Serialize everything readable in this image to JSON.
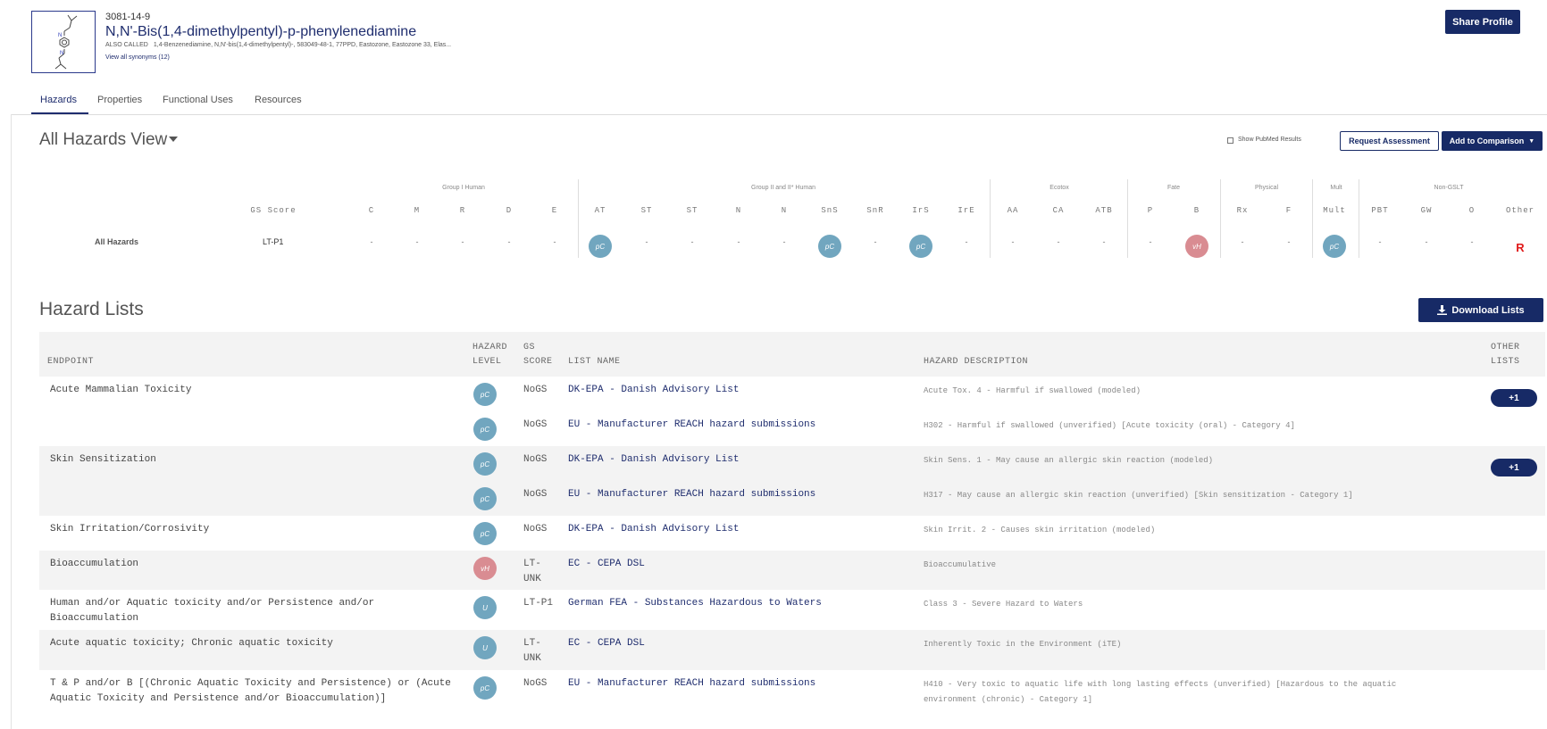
{
  "header": {
    "cas": "3081-14-9",
    "name": "N,N'-Bis(1,4-dimethylpentyl)-p-phenylenediamine",
    "also_called_label": "ALSO CALLED",
    "also_called": "1,4-Benzenediamine, N,N'-bis(1,4-dimethylpentyl)-, 583049-48-1, 77PPD, Eastozone, Eastozone 33, Elas...",
    "view_synonyms": "View all synonyms (12)",
    "share_label": "Share Profile"
  },
  "tabs": [
    "Hazards",
    "Properties",
    "Functional Uses",
    "Resources"
  ],
  "hazards_view": {
    "title": "All Hazards View",
    "pubmed_label": "Show PubMed Results",
    "request_label": "Request Assessment",
    "compare_label": "Add to Comparison"
  },
  "groups": [
    "Group I Human",
    "Group II and II* Human",
    "Ecotox",
    "Fate",
    "Physical",
    "Mult",
    "Non-GSLT"
  ],
  "columns": [
    "GS Score",
    "C",
    "M",
    "R",
    "D",
    "E",
    "AT",
    "ST",
    "ST",
    "N",
    "N",
    "SnS",
    "SnR",
    "IrS",
    "IrE",
    "AA",
    "CA",
    "ATB",
    "P",
    "B",
    "Rx",
    "F",
    "Mult",
    "PBT",
    "GW",
    "O",
    "Other"
  ],
  "all_hazards_row": {
    "label": "All Hazards",
    "gs_score": "LT-P1",
    "cells": [
      "-",
      "-",
      "-",
      "-",
      "-",
      "pC",
      "-",
      "-",
      "-",
      "-",
      "pC",
      "-",
      "pC",
      "-",
      "-",
      "-",
      "-",
      "-",
      "vH",
      "-",
      "-",
      "pC",
      "-",
      "-",
      "-",
      "R"
    ]
  },
  "hazard_lists": {
    "title": "Hazard Lists",
    "download_label": "Download Lists",
    "headers": {
      "endpoint": "ENDPOINT",
      "hazard_level_1": "HAZARD",
      "hazard_level_2": "LEVEL",
      "gs_score_1": "GS",
      "gs_score_2": "SCORE",
      "list_name": "LIST NAME",
      "hazard_description": "HAZARD DESCRIPTION",
      "other_lists_1": "OTHER",
      "other_lists_2": "LISTS"
    },
    "rows": [
      {
        "endpoint": "Acute Mammalian Toxicity",
        "level": "pC",
        "gs": "NoGS",
        "list": "DK-EPA - Danish Advisory List",
        "desc": "Acute Tox. 4 - Harmful if swallowed (modeled)",
        "other": "+1"
      },
      {
        "endpoint": "",
        "level": "pC",
        "gs": "NoGS",
        "list": "EU - Manufacturer REACH hazard submissions",
        "desc": "H302 - Harmful if swallowed (unverified) [Acute toxicity (oral) - Category 4]",
        "other": ""
      },
      {
        "endpoint": "Skin Sensitization",
        "level": "pC",
        "gs": "NoGS",
        "list": "DK-EPA - Danish Advisory List",
        "desc": "Skin Sens. 1 - May cause an allergic skin reaction (modeled)",
        "other": "+1"
      },
      {
        "endpoint": "",
        "level": "pC",
        "gs": "NoGS",
        "list": "EU - Manufacturer REACH hazard submissions",
        "desc": "H317 - May cause an allergic skin reaction (unverified) [Skin sensitization - Category 1]",
        "other": ""
      },
      {
        "endpoint": "Skin Irritation/Corrosivity",
        "level": "pC",
        "gs": "NoGS",
        "list": "DK-EPA - Danish Advisory List",
        "desc": "Skin Irrit. 2 - Causes skin irritation (modeled)",
        "other": ""
      },
      {
        "endpoint": "Bioaccumulation",
        "level": "vH",
        "gs": "LT-\nUNK",
        "list": "EC - CEPA DSL",
        "desc": "Bioaccumulative",
        "other": ""
      },
      {
        "endpoint": "Human and/or Aquatic toxicity and/or Persistence and/or\nBioaccumulation",
        "level": "U",
        "gs": "LT-P1",
        "list": "German FEA - Substances Hazardous to Waters",
        "desc": "Class 3 - Severe Hazard to Waters",
        "other": ""
      },
      {
        "endpoint": "Acute aquatic toxicity; Chronic aquatic toxicity",
        "level": "U",
        "gs": "LT-\nUNK",
        "list": "EC - CEPA DSL",
        "desc": "Inherently Toxic in the Environment (iTE)",
        "other": ""
      },
      {
        "endpoint": "T & P and/or B [(Chronic Aquatic Toxicity and Persistence) or (Acute\nAquatic Toxicity and Persistence and/or Bioaccumulation)]",
        "level": "pC",
        "gs": "NoGS",
        "list": "EU - Manufacturer REACH hazard submissions",
        "desc": "H410 - Very toxic to aquatic life with long lasting effects (unverified) [Hazardous to the aquatic\nenvironment (chronic) - Category 1]",
        "other": ""
      }
    ]
  }
}
